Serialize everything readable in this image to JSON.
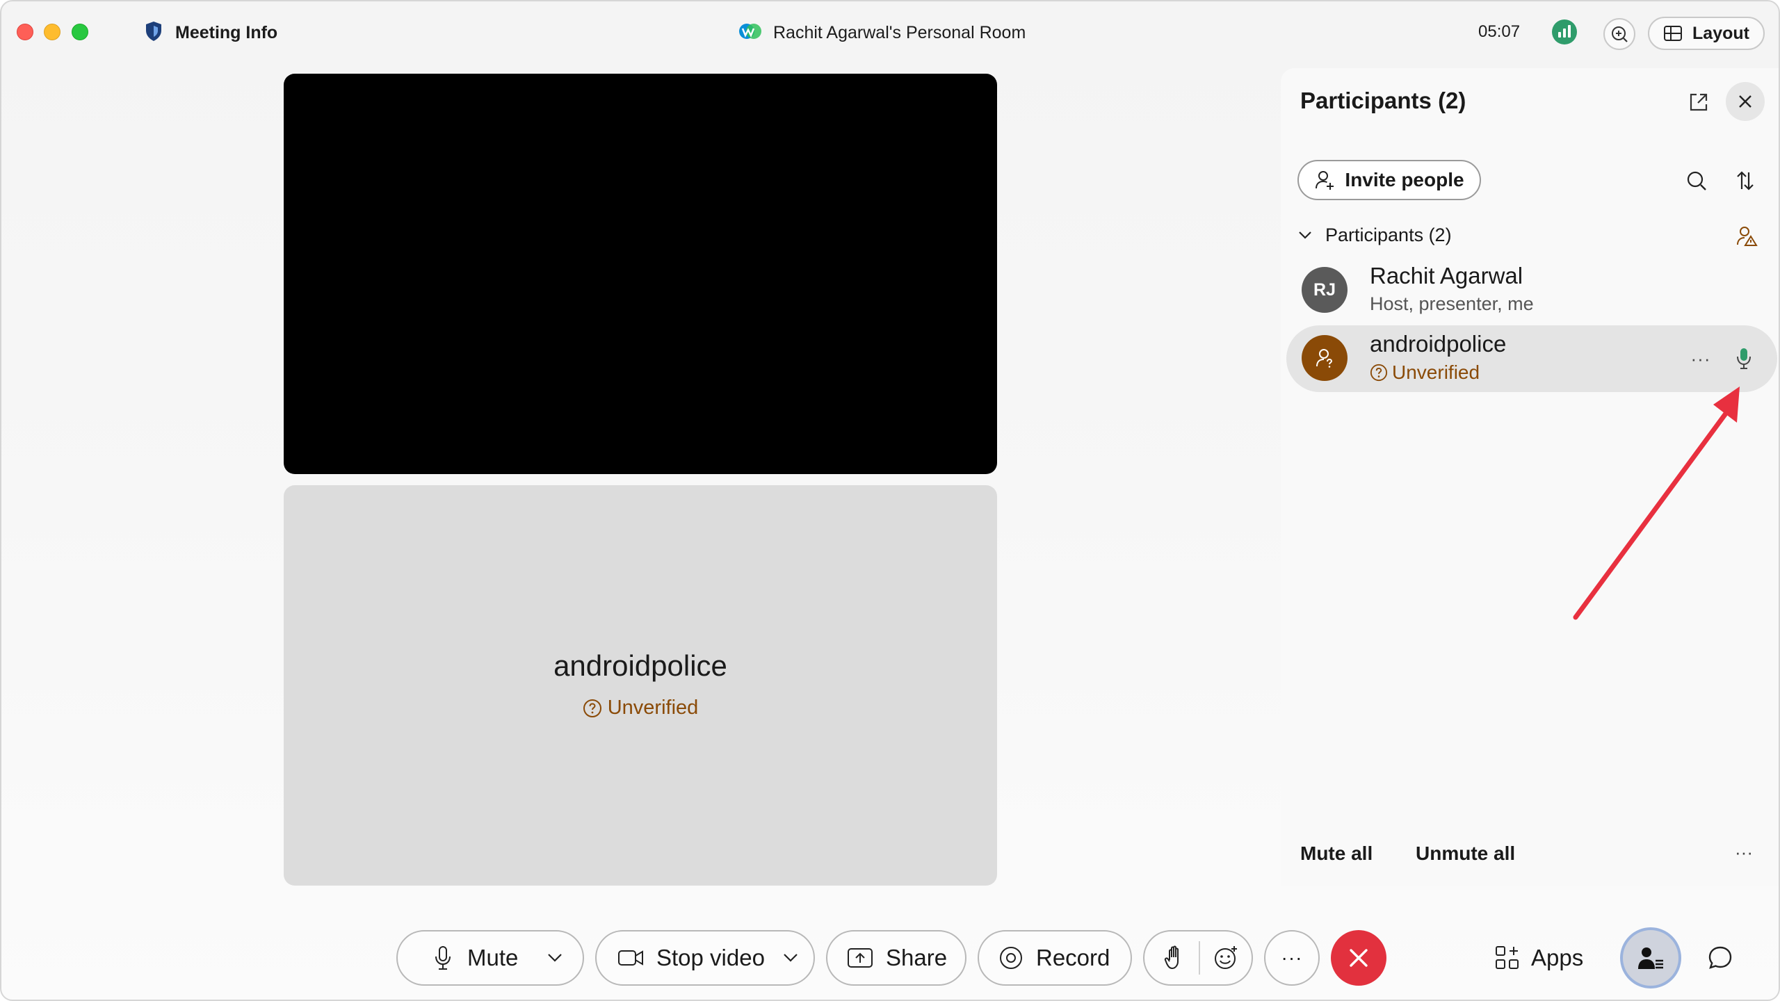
{
  "titlebar": {
    "meeting_info": "Meeting Info",
    "room_title": "Rachit Agarwal's Personal Room",
    "time": "05:07",
    "layout_label": "Layout"
  },
  "stage": {
    "participant_tile_name": "androidpolice",
    "participant_tile_status": "Unverified"
  },
  "panel": {
    "title": "Participants (2)",
    "invite_label": "Invite people",
    "section_label": "Participants (2)",
    "participants": [
      {
        "initials": "RJ",
        "name": "Rachit Agarwal",
        "role": "Host, presenter, me",
        "avatar_color": "#5a5a5a"
      },
      {
        "name": "androidpolice",
        "status": "Unverified",
        "avatar_color": "#8a4a07"
      }
    ],
    "mute_all": "Mute all",
    "unmute_all": "Unmute all",
    "more": "···"
  },
  "controls": {
    "mute": "Mute",
    "stop_video": "Stop video",
    "share": "Share",
    "record": "Record",
    "more": "···",
    "apps": "Apps"
  },
  "colors": {
    "leave": "#e2313e",
    "unverified": "#8a4a07",
    "annotation_arrow": "#e8303f",
    "mic_active": "#2f9c6b"
  }
}
